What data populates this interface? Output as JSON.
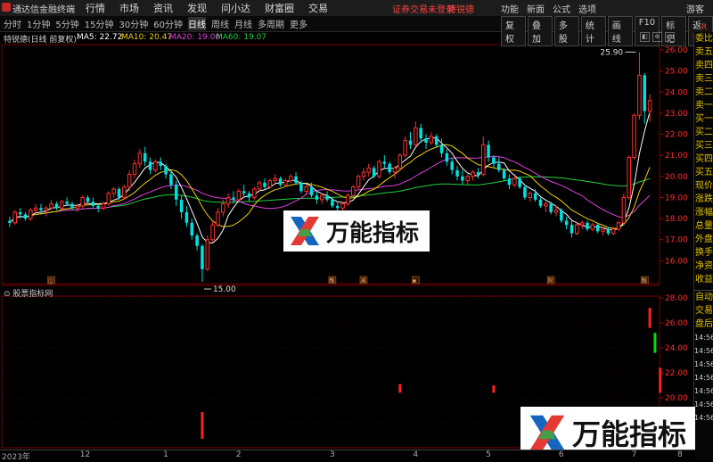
{
  "window": {
    "app_title": "通达信金融终端",
    "menu": [
      "行情",
      "市场",
      "资讯",
      "发现",
      "问小达",
      "财富圈",
      "交易"
    ],
    "login_status": "证券交易未登录",
    "user_label": "特锐德",
    "right_menu": [
      "功能",
      "新面",
      "公式",
      "选项"
    ],
    "guest": "游客"
  },
  "toolbar": {
    "periods": [
      "分时",
      "1分钟",
      "5分钟",
      "15分钟",
      "30分钟",
      "60分钟",
      "日线",
      "周线",
      "月线",
      "多周期",
      "更多"
    ],
    "active_period": "日线",
    "tools": [
      "复权",
      "叠加",
      "多股",
      "统计",
      "画线",
      "F10",
      "标记",
      "返回"
    ]
  },
  "info": {
    "stock_label": "特锐德(日线 前复权)",
    "ma": [
      {
        "label": "MA5: 22.72",
        "color": "#ffffff"
      },
      {
        "label": "MA10: 20.47",
        "color": "#f0d000"
      },
      {
        "label": "MA20: 19.00",
        "color": "#e040e0"
      },
      {
        "label": "MA60: 19.07",
        "color": "#20d040"
      }
    ],
    "icons": [
      "◧",
      "⊕",
      "⊘"
    ]
  },
  "right_panel": {
    "top": [
      "委比",
      "卖五",
      "卖四",
      "卖三",
      "卖二",
      "卖一",
      "买一",
      "买二",
      "买三",
      "买四",
      "买五",
      "现价",
      "涨跌",
      "涨幅",
      "总量",
      "外盘",
      "换手",
      "净资",
      "收益"
    ],
    "bottom": [
      "自动",
      "交易",
      "盘后",
      "14:56",
      "14:56",
      "14:56",
      "14:56",
      "14:56",
      "14:56",
      "14:56"
    ],
    "corner": "R"
  },
  "main_axis": {
    "labels": [
      "26.00",
      "25.00",
      "24.00",
      "23.00",
      "22.00",
      "21.00",
      "20.00",
      "19.00",
      "18.00",
      "17.00",
      "16.00"
    ],
    "high_label": "25.90",
    "low_label": "15.00"
  },
  "sub_chart": {
    "title": "股票指标网",
    "axis_labels": [
      "28.00",
      "26.00",
      "24.00",
      "22.00",
      "20.00",
      "18.00"
    ]
  },
  "x_axis": {
    "labels": [
      "2023年",
      "12",
      "1",
      "2",
      "3",
      "4",
      "5",
      "6",
      "7",
      "8"
    ]
  },
  "event_markers": [
    "◫",
    "融",
    "减",
    "▪",
    "财",
    "融"
  ],
  "watermark": {
    "text": "万能指标"
  },
  "colors": {
    "up": "#ff3030",
    "down": "#00e0e0",
    "ma5": "#ffffff",
    "ma10": "#f0d000",
    "ma20": "#e040e0",
    "ma60": "#20d040",
    "grid": "#7a0000"
  },
  "chart_data": {
    "type": "candlestick",
    "ohlc": [
      [
        17.9,
        18.1,
        17.6,
        17.8
      ],
      [
        17.8,
        18.4,
        17.7,
        18.3
      ],
      [
        18.3,
        18.5,
        18.0,
        18.2
      ],
      [
        18.2,
        18.3,
        17.9,
        18.0
      ],
      [
        18.0,
        18.5,
        17.9,
        18.4
      ],
      [
        18.4,
        18.7,
        18.2,
        18.5
      ],
      [
        18.5,
        18.7,
        18.3,
        18.4
      ],
      [
        18.4,
        18.6,
        18.1,
        18.5
      ],
      [
        18.5,
        18.9,
        18.4,
        18.7
      ],
      [
        18.7,
        18.8,
        18.4,
        18.5
      ],
      [
        18.5,
        18.9,
        18.4,
        18.8
      ],
      [
        18.8,
        19.0,
        18.6,
        18.7
      ],
      [
        18.7,
        18.8,
        18.4,
        18.5
      ],
      [
        18.5,
        18.7,
        18.3,
        18.6
      ],
      [
        18.6,
        19.1,
        18.5,
        19.0
      ],
      [
        19.0,
        19.1,
        18.7,
        18.8
      ],
      [
        18.8,
        19.0,
        18.5,
        18.6
      ],
      [
        18.6,
        18.7,
        18.3,
        18.5
      ],
      [
        18.5,
        18.8,
        18.4,
        18.7
      ],
      [
        18.7,
        19.3,
        18.6,
        19.2
      ],
      [
        19.2,
        19.5,
        19.0,
        19.4
      ],
      [
        19.4,
        19.5,
        18.9,
        19.0
      ],
      [
        19.0,
        19.6,
        18.9,
        19.5
      ],
      [
        19.5,
        20.3,
        19.3,
        20.1
      ],
      [
        20.1,
        20.8,
        19.9,
        20.6
      ],
      [
        20.6,
        21.3,
        20.4,
        21.1
      ],
      [
        21.1,
        21.4,
        20.5,
        20.7
      ],
      [
        20.7,
        20.9,
        20.1,
        20.3
      ],
      [
        20.3,
        20.8,
        20.2,
        20.7
      ],
      [
        20.7,
        20.9,
        20.3,
        20.5
      ],
      [
        20.5,
        20.6,
        19.9,
        20.1
      ],
      [
        20.1,
        20.3,
        19.4,
        19.6
      ],
      [
        19.6,
        19.8,
        18.6,
        18.9
      ],
      [
        18.9,
        19.1,
        18.0,
        18.3
      ],
      [
        18.3,
        18.6,
        17.6,
        17.8
      ],
      [
        17.8,
        18.0,
        17.0,
        17.2
      ],
      [
        17.2,
        17.3,
        16.5,
        16.7
      ],
      [
        16.7,
        16.8,
        15.0,
        15.6
      ],
      [
        15.6,
        17.2,
        15.5,
        17.0
      ],
      [
        17.0,
        17.9,
        16.9,
        17.7
      ],
      [
        17.7,
        18.5,
        17.6,
        18.3
      ],
      [
        18.3,
        18.9,
        18.1,
        18.7
      ],
      [
        18.7,
        19.2,
        18.5,
        19.0
      ],
      [
        19.0,
        19.3,
        18.7,
        18.9
      ],
      [
        18.9,
        19.4,
        18.8,
        19.3
      ],
      [
        19.3,
        19.6,
        19.0,
        19.2
      ],
      [
        19.2,
        19.3,
        18.8,
        19.0
      ],
      [
        19.0,
        19.5,
        18.9,
        19.4
      ],
      [
        19.4,
        19.8,
        19.3,
        19.7
      ],
      [
        19.7,
        19.9,
        19.4,
        19.5
      ],
      [
        19.5,
        19.9,
        19.4,
        19.8
      ],
      [
        19.8,
        20.1,
        19.6,
        19.9
      ],
      [
        19.9,
        20.0,
        19.5,
        19.6
      ],
      [
        19.6,
        19.9,
        19.5,
        19.8
      ],
      [
        19.8,
        20.1,
        19.7,
        20.0
      ],
      [
        20.0,
        20.2,
        19.6,
        19.7
      ],
      [
        19.7,
        19.8,
        19.2,
        19.3
      ],
      [
        19.3,
        19.6,
        19.1,
        19.5
      ],
      [
        19.5,
        19.7,
        19.0,
        19.1
      ],
      [
        19.1,
        19.3,
        18.7,
        18.9
      ],
      [
        18.9,
        19.2,
        18.7,
        19.1
      ],
      [
        19.1,
        19.3,
        18.8,
        18.9
      ],
      [
        18.9,
        19.0,
        18.5,
        18.6
      ],
      [
        18.6,
        18.8,
        18.3,
        18.5
      ],
      [
        18.5,
        18.8,
        18.2,
        18.7
      ],
      [
        18.7,
        19.2,
        18.6,
        19.1
      ],
      [
        19.1,
        19.6,
        19.0,
        19.5
      ],
      [
        19.5,
        20.1,
        19.4,
        20.0
      ],
      [
        20.0,
        20.4,
        19.8,
        20.2
      ],
      [
        20.2,
        20.6,
        20.0,
        20.4
      ],
      [
        20.4,
        20.5,
        19.9,
        20.0
      ],
      [
        20.0,
        20.8,
        19.9,
        20.7
      ],
      [
        20.7,
        21.0,
        20.4,
        20.6
      ],
      [
        20.6,
        20.7,
        20.1,
        20.2
      ],
      [
        20.2,
        20.5,
        19.9,
        20.4
      ],
      [
        20.4,
        21.1,
        20.3,
        21.0
      ],
      [
        21.0,
        21.9,
        20.9,
        21.7
      ],
      [
        21.7,
        22.1,
        21.3,
        21.5
      ],
      [
        21.5,
        22.6,
        21.4,
        22.3
      ],
      [
        22.3,
        22.5,
        21.6,
        21.8
      ],
      [
        21.8,
        22.0,
        21.3,
        21.6
      ],
      [
        21.6,
        22.1,
        21.5,
        21.9
      ],
      [
        21.9,
        22.0,
        21.4,
        21.5
      ],
      [
        21.5,
        21.8,
        20.9,
        21.1
      ],
      [
        21.1,
        21.3,
        20.5,
        20.7
      ],
      [
        20.7,
        20.9,
        20.1,
        20.3
      ],
      [
        20.3,
        20.5,
        19.8,
        20.0
      ],
      [
        20.0,
        20.3,
        19.6,
        19.8
      ],
      [
        19.8,
        20.1,
        19.6,
        20.0
      ],
      [
        20.0,
        20.3,
        19.8,
        20.2
      ],
      [
        20.2,
        20.4,
        19.9,
        20.1
      ],
      [
        20.1,
        21.9,
        20.0,
        21.5
      ],
      [
        21.5,
        21.7,
        20.7,
        20.9
      ],
      [
        20.9,
        21.0,
        20.4,
        20.6
      ],
      [
        20.6,
        20.9,
        20.2,
        20.3
      ],
      [
        20.3,
        20.4,
        19.8,
        19.9
      ],
      [
        19.9,
        20.1,
        19.4,
        19.6
      ],
      [
        19.6,
        20.0,
        19.5,
        19.9
      ],
      [
        19.9,
        20.0,
        19.4,
        19.5
      ],
      [
        19.5,
        19.6,
        18.9,
        19.0
      ],
      [
        19.0,
        19.3,
        18.8,
        19.2
      ],
      [
        19.2,
        19.4,
        18.8,
        18.9
      ],
      [
        18.9,
        19.0,
        18.5,
        18.6
      ],
      [
        18.6,
        18.8,
        18.3,
        18.7
      ],
      [
        18.7,
        18.8,
        18.2,
        18.3
      ],
      [
        18.3,
        18.6,
        18.1,
        18.4
      ],
      [
        18.4,
        18.5,
        17.8,
        17.9
      ],
      [
        17.9,
        18.1,
        17.5,
        17.7
      ],
      [
        17.7,
        17.9,
        17.1,
        17.3
      ],
      [
        17.3,
        17.8,
        17.2,
        17.7
      ],
      [
        17.7,
        17.9,
        17.5,
        17.8
      ],
      [
        17.8,
        17.9,
        17.4,
        17.5
      ],
      [
        17.5,
        17.8,
        17.4,
        17.7
      ],
      [
        17.7,
        17.8,
        17.3,
        17.4
      ],
      [
        17.4,
        17.6,
        17.2,
        17.5
      ],
      [
        17.5,
        17.6,
        17.2,
        17.3
      ],
      [
        17.3,
        17.6,
        17.2,
        17.5
      ],
      [
        17.5,
        17.9,
        17.4,
        17.8
      ],
      [
        17.8,
        19.2,
        17.7,
        19.0
      ],
      [
        19.0,
        21.0,
        18.9,
        20.9
      ],
      [
        20.9,
        23.0,
        20.8,
        22.9
      ],
      [
        22.9,
        25.9,
        22.7,
        24.8
      ],
      [
        24.8,
        24.9,
        22.5,
        23.1
      ],
      [
        23.1,
        23.9,
        22.6,
        23.6
      ]
    ],
    "ylim": [
      15.0,
      26.0
    ],
    "indicator_bars": [
      {
        "i": 37,
        "color": "#ff2020"
      },
      {
        "i": 75,
        "color": "#ff2020"
      },
      {
        "i": 93,
        "color": "#ff2020"
      },
      {
        "i": 123,
        "color": "#ff2020"
      },
      {
        "i": 124,
        "color": "#00e000"
      },
      {
        "i": 125,
        "color": "#ff2020"
      }
    ]
  }
}
